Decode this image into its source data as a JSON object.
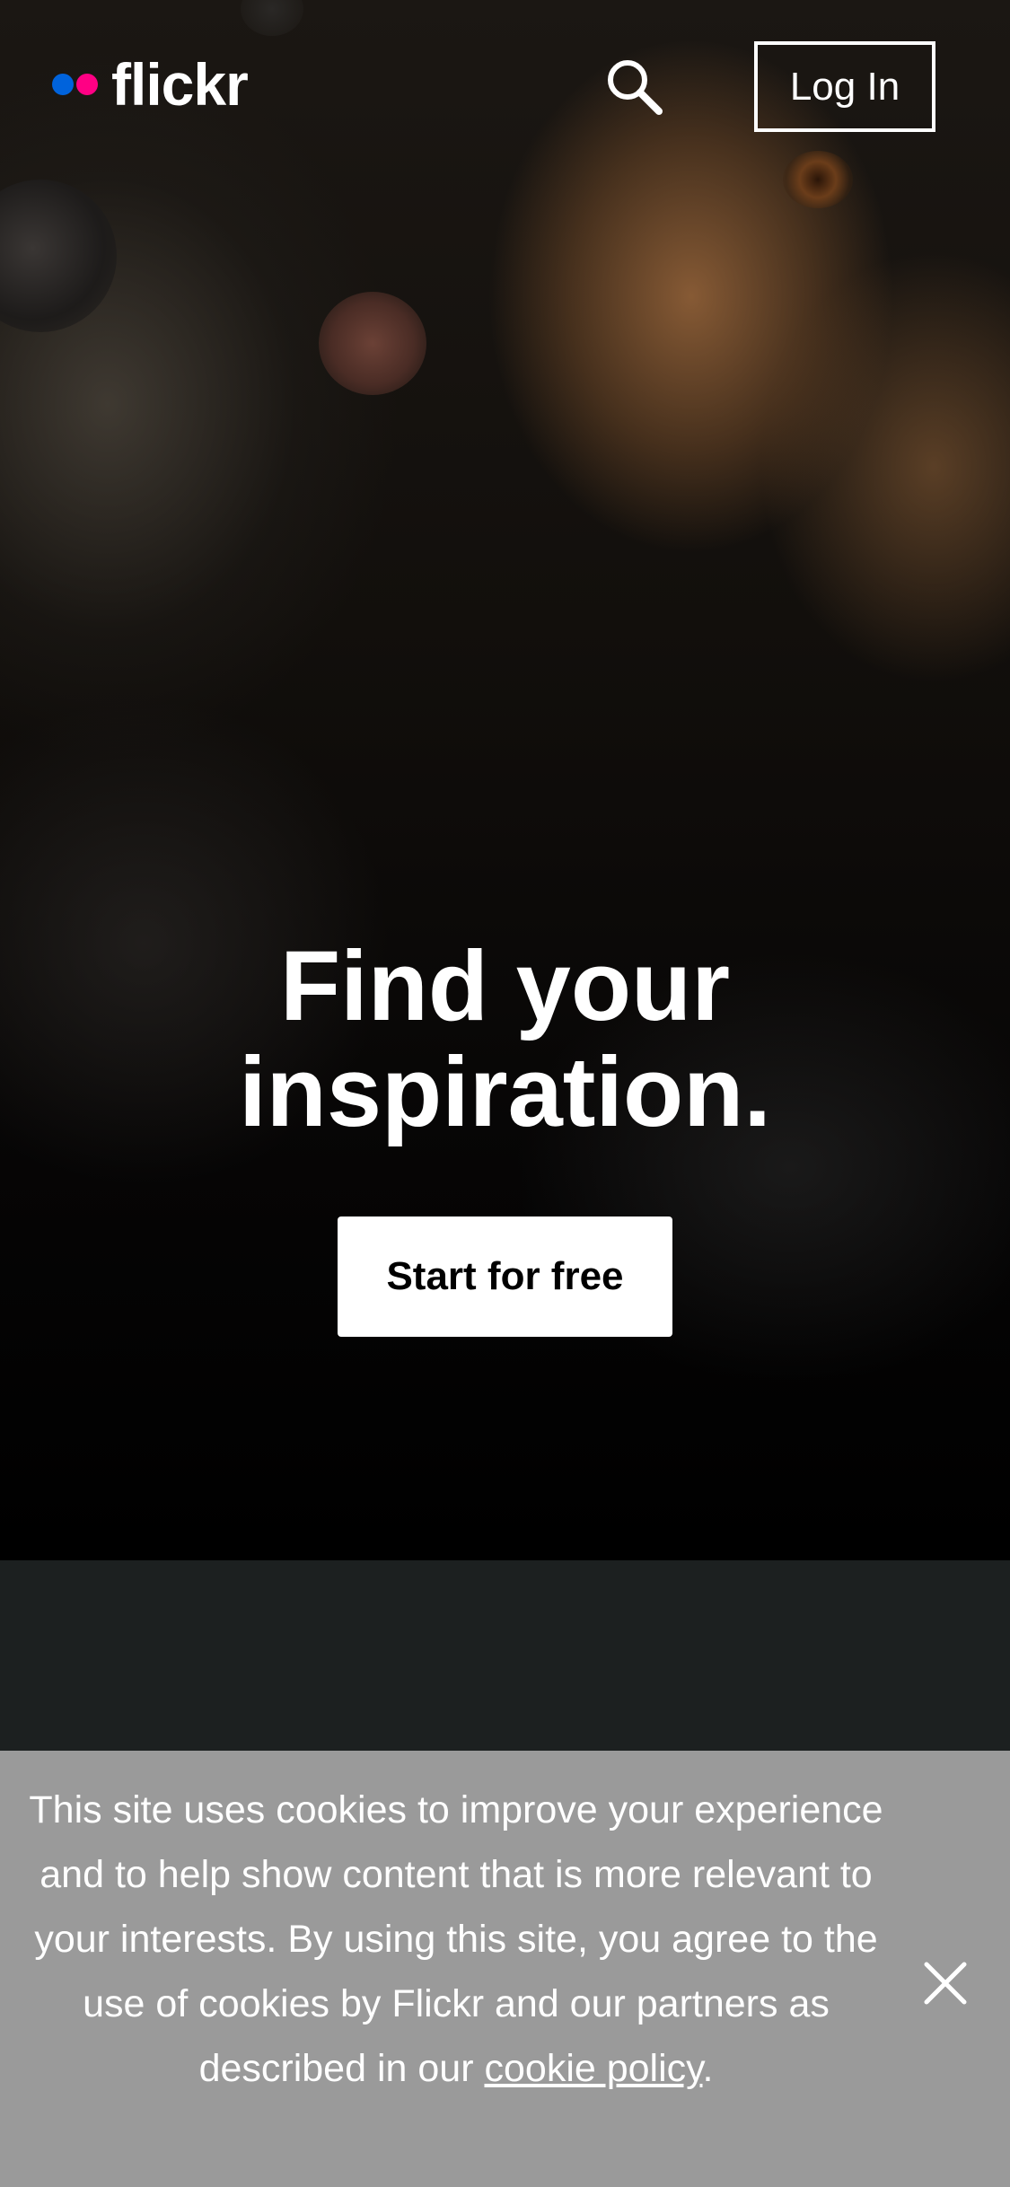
{
  "header": {
    "logo_text": "flickr",
    "logo_dot_colors": [
      "#0063dc",
      "#ff0084"
    ],
    "search_icon": "search-icon",
    "login_label": "Log In"
  },
  "hero": {
    "headline_line1": "Find your",
    "headline_line2": "inspiration.",
    "cta_label": "Start for free"
  },
  "cookie_banner": {
    "text": "This site uses cookies to improve your experience and to help show content that is more relevant to your interests. By using this site, you agree to the use of cookies by Flickr and our partners as described in our",
    "link_text": "cookie policy",
    "trailing": ".",
    "close_icon": "close-icon"
  },
  "colors": {
    "brand_blue": "#0063dc",
    "brand_pink": "#ff0084",
    "cookie_bg": "#9a9a9a",
    "band_bg": "#1c2020"
  }
}
